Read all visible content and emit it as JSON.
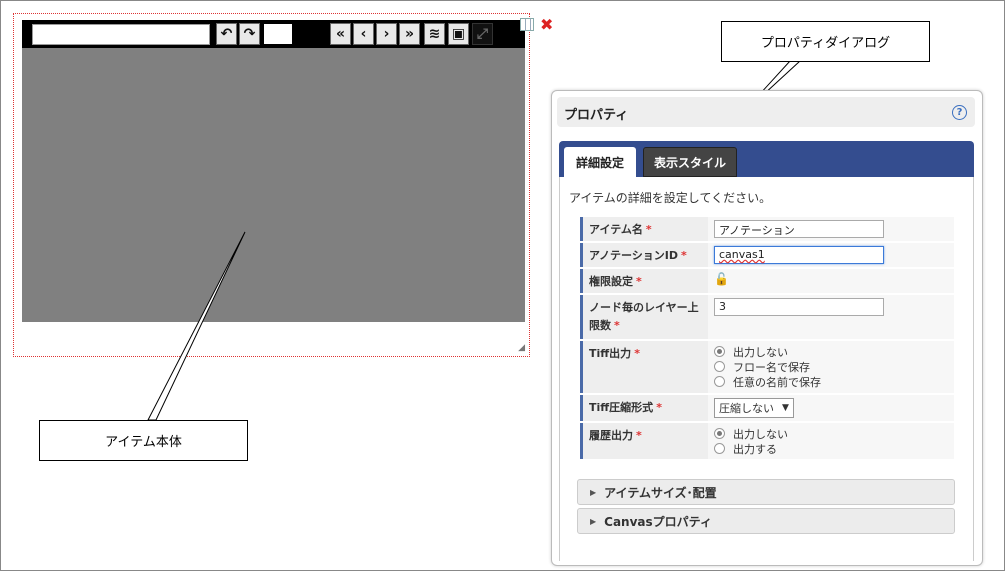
{
  "toolbar": {
    "icons": [
      "undo-icon",
      "redo-icon",
      "first-page-icon",
      "prev-page-icon",
      "next-page-icon",
      "last-page-icon",
      "layers-icon",
      "image-icon",
      "fullscreen-icon"
    ],
    "glyphs": {
      "undo": "↶",
      "redo": "↷",
      "first": "«",
      "prev": "‹",
      "next": "›",
      "last": "»",
      "layers": "≋",
      "image": "▣",
      "fullscreen": "⤢"
    }
  },
  "callouts": {
    "item_body": "アイテム本体",
    "property_dialog": "プロパティダイアログ"
  },
  "dialog": {
    "title": "プロパティ",
    "help": "?",
    "tabs": [
      "詳細設定",
      "表示スタイル"
    ],
    "description": "アイテムの詳細を設定してください。",
    "required_mark": "*",
    "fields": {
      "item_name": {
        "label": "アイテム名",
        "value": "アノテーション"
      },
      "annotation_id": {
        "label": "アノテーションID",
        "value": "canvas1"
      },
      "permission": {
        "label": "権限設定"
      },
      "layers_per_node": {
        "label": "ノード毎のレイヤー上限数",
        "value": "3"
      },
      "tiff_output": {
        "label": "Tiff出力",
        "options": [
          "出力しない",
          "フロー名で保存",
          "任意の名前で保存"
        ],
        "selected": 0
      },
      "tiff_compression": {
        "label": "Tiff圧縮形式",
        "value": "圧縮しない"
      },
      "history_output": {
        "label": "履歴出力",
        "options": [
          "出力しない",
          "出力する"
        ],
        "selected": 0
      }
    },
    "accordions": [
      "アイテムサイズ･配置",
      "Canvasプロパティ"
    ]
  },
  "colors": {
    "tab_bar": "#344d8f",
    "canvas": "#808080",
    "required": "#dd3333"
  }
}
